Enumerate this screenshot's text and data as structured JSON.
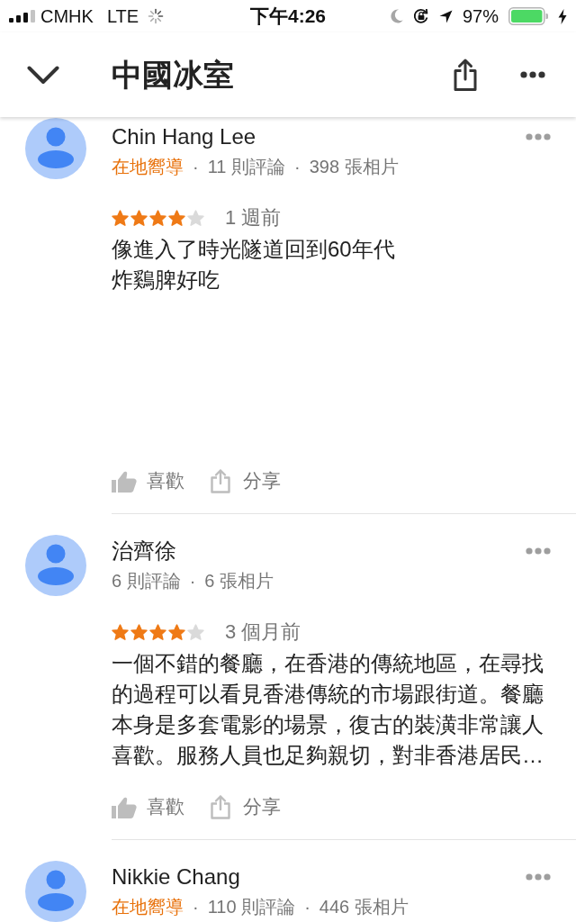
{
  "status_bar": {
    "carrier": "CMHK",
    "network": "LTE",
    "time": "下午4:26",
    "battery": "97%"
  },
  "header": {
    "title": "中國冰室"
  },
  "reviews": [
    {
      "name": "Chin Hang Lee",
      "meta": [
        {
          "kind": "guide",
          "text": "在地嚮導"
        },
        {
          "kind": "separator",
          "text": "·"
        },
        {
          "kind": "count",
          "text": "11 則評論"
        },
        {
          "kind": "separator",
          "text": "·"
        },
        {
          "kind": "count",
          "text": "398 張相片"
        }
      ],
      "stars": 4,
      "date": "1 週前",
      "lines": [
        "像進入了時光隧道回到60年代",
        "炸鷄脾好吃"
      ],
      "actions": [
        {
          "kind": "like",
          "label": "喜歡"
        },
        {
          "kind": "share",
          "label": "分享"
        }
      ]
    },
    {
      "name": "治齊徐",
      "meta": [
        {
          "kind": "count",
          "text": "6 則評論"
        },
        {
          "kind": "separator",
          "text": "·"
        },
        {
          "kind": "count",
          "text": "6 張相片"
        }
      ],
      "stars": 4,
      "date": "3 個月前",
      "lines": [
        "一個不錯的餐廳，在香港的傳統地區，在尋找的過程可以看見香港傳統的市場跟街道。餐廳本身是多套電影的場景，復古的裝潢非常讓人喜歡。服務人員也足夠親切，對非香港居民…"
      ],
      "actions": [
        {
          "kind": "like",
          "label": "喜歡"
        },
        {
          "kind": "share",
          "label": "分享"
        }
      ]
    },
    {
      "name": "Nikkie Chang",
      "meta": [
        {
          "kind": "guide",
          "text": "在地嚮導"
        },
        {
          "kind": "separator",
          "text": "·"
        },
        {
          "kind": "count",
          "text": "110 則評論"
        },
        {
          "kind": "separator",
          "text": "·"
        },
        {
          "kind": "count",
          "text": "446 張相片"
        }
      ]
    }
  ]
}
